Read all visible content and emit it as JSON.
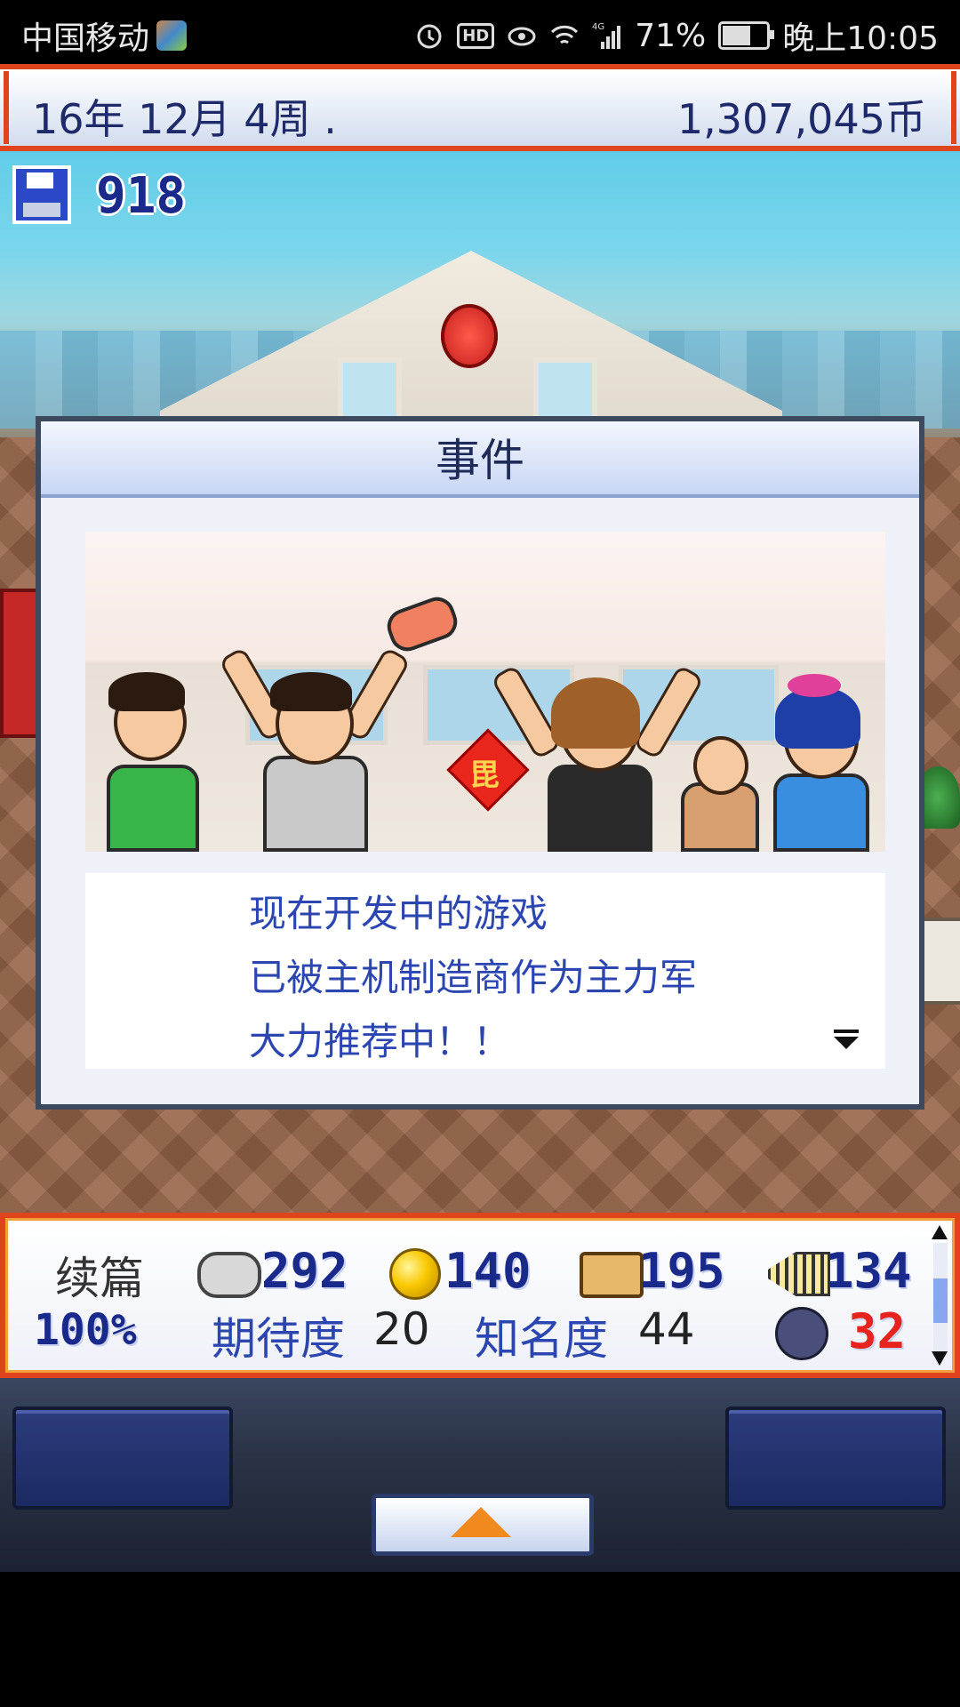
{
  "status_bar": {
    "carrier": "中国移动",
    "network": "4G",
    "battery": "71%",
    "battery_level": 0.71,
    "time": "晚上10:05",
    "icons": [
      "alarm-icon",
      "hd-icon",
      "eye-icon",
      "wifi-icon",
      "signal-icon",
      "battery-icon"
    ]
  },
  "topbar": {
    "date": "16年 12月 4周 .",
    "money": "1,307,045币"
  },
  "save": {
    "points": "918",
    "icon": "floppy-disk-icon"
  },
  "dialog": {
    "title": "事件",
    "message_lines": [
      "现在开发中的游戏",
      "已被主机制造商作为主力军",
      "大力推荐中！！"
    ],
    "sign_char": "毘"
  },
  "stats": {
    "genre_label": "续篇",
    "progress": "100%",
    "fun": "292",
    "creativity": "140",
    "graphics": "195",
    "sound": "134",
    "expectation_label": "期待度",
    "expectation_value": "20",
    "fame_label": "知名度",
    "fame_value": "44",
    "bugs": "32",
    "colors": {
      "label_blue": "#2b46b0",
      "bug_red": "#e8221c",
      "number_navy": "#1a2a8a"
    }
  },
  "controls": {
    "up_icon": "up-arrow-icon"
  }
}
